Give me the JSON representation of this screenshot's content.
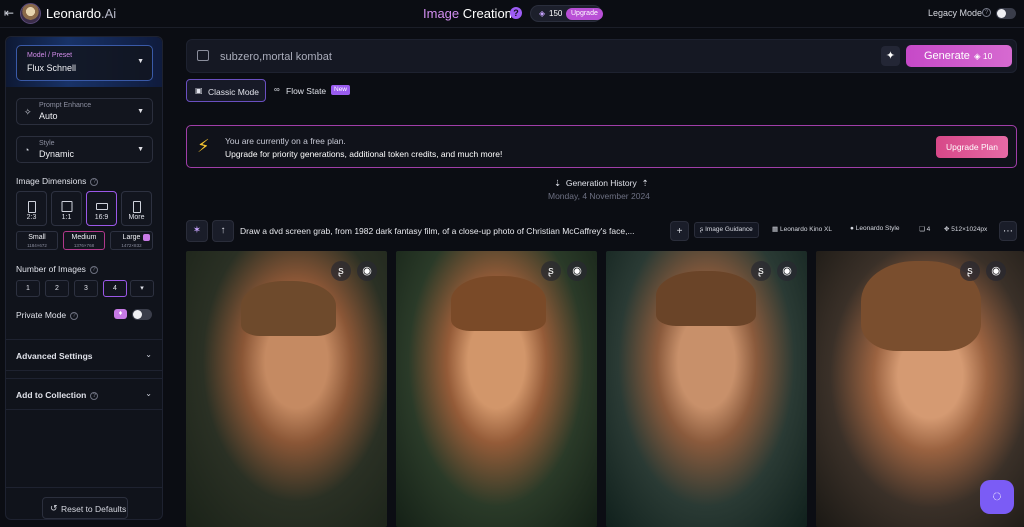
{
  "header": {
    "brand": "Leonardo",
    "brand_suffix": ".Ai",
    "title_part1": "Image",
    "title_part2": "Creation",
    "help": "?",
    "tokens": "150",
    "upgrade": "Upgrade",
    "legacy_mode": "Legacy Mode"
  },
  "sidebar": {
    "preset_label": "Model / Preset",
    "preset_value": "Flux Schnell",
    "prompt_enhance_label": "Prompt Enhance",
    "prompt_enhance_value": "Auto",
    "style_label": "Style",
    "style_value": "Dynamic",
    "dimensions_label": "Image Dimensions",
    "ratios": [
      "2:3",
      "1:1",
      "16:9",
      "More"
    ],
    "sizes": [
      {
        "label": "Small",
        "dims": "1184×672"
      },
      {
        "label": "Medium",
        "dims": "1376×768"
      },
      {
        "label": "Large",
        "dims": "1472×832"
      }
    ],
    "num_images_label": "Number of Images",
    "num_images": [
      "1",
      "2",
      "3",
      "4"
    ],
    "private_mode_label": "Private Mode",
    "advanced_settings": "Advanced Settings",
    "add_to_collection": "Add to Collection",
    "reset_defaults": "Reset to Defaults"
  },
  "prompt": {
    "text": "subzero,mortal kombat",
    "generate": "Generate",
    "generate_cost": "10"
  },
  "modes": {
    "classic": "Classic Mode",
    "flow": "Flow State",
    "new_badge": "New"
  },
  "banner": {
    "line1": "You are currently on a free plan.",
    "line2": "Upgrade for priority generations, additional token credits, and much more!",
    "button": "Upgrade Plan"
  },
  "history": {
    "title": "Generation History",
    "date": "Monday, 4 November 2024"
  },
  "generation": {
    "prompt": "Draw a dvd screen grab, from 1982 dark fantasy film, of a close-up photo of Christian McCaffrey's face,...",
    "image_guidance": "Image Guidance",
    "model": "Leonardo Kino XL",
    "style": "Leonardo Style",
    "count": "4",
    "resolution": "512×1024px"
  },
  "colors": {
    "accent_purple": "#9b58e8",
    "generate_pink": "#c649c8",
    "banner_border": "#a03ea8"
  }
}
